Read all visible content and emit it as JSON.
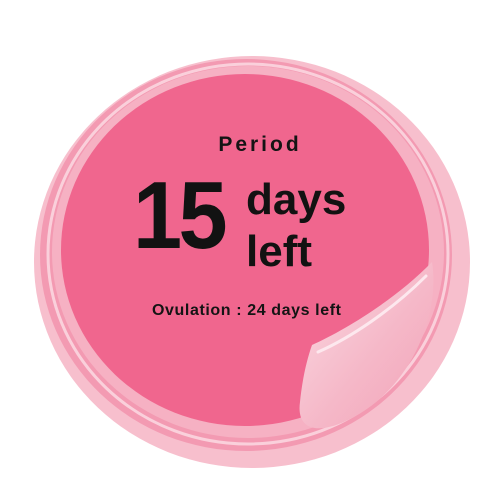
{
  "period": {
    "label": "Period",
    "days_count": "15",
    "days_word": "days",
    "left_word": "left"
  },
  "ovulation": {
    "text": "Ovulation : 24 days left"
  },
  "colors": {
    "face": "#f0668e",
    "rim": "#f4a6ba",
    "curl": "#f8cbd6",
    "text": "#141414"
  }
}
